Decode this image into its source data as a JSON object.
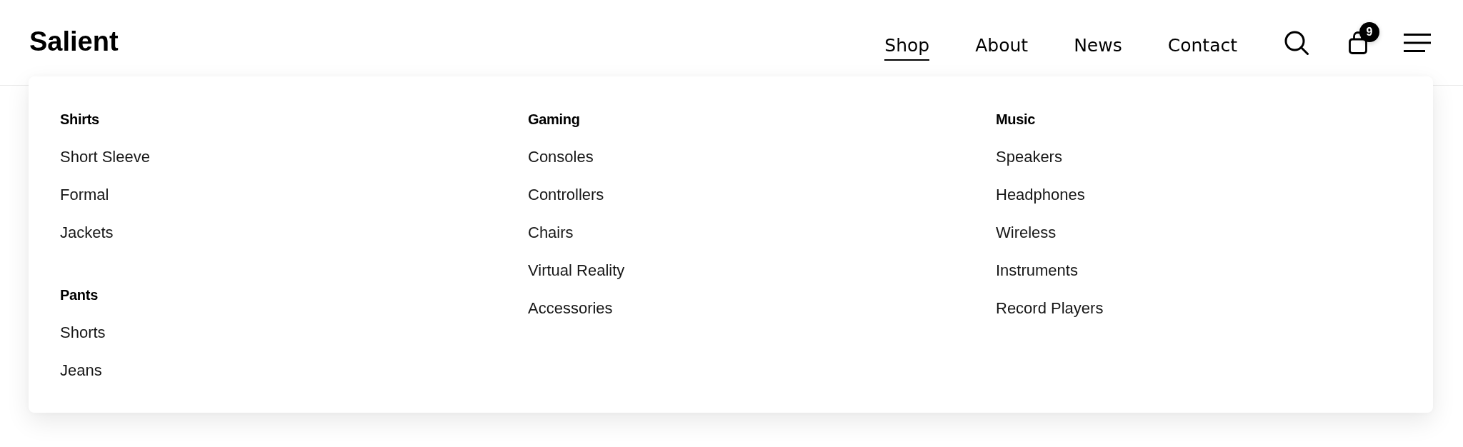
{
  "header": {
    "logo": "Salient",
    "nav": [
      {
        "label": "Shop",
        "selected": true
      },
      {
        "label": "About",
        "selected": false
      },
      {
        "label": "News",
        "selected": false
      },
      {
        "label": "Contact",
        "selected": false
      }
    ],
    "cart": {
      "count": "9"
    }
  },
  "mega_menu": {
    "columns": [
      {
        "groups": [
          {
            "heading": "Shirts",
            "items": [
              "Short Sleeve",
              "Formal",
              "Jackets"
            ]
          },
          {
            "heading": "Pants",
            "items": [
              "Shorts",
              "Jeans"
            ]
          }
        ]
      },
      {
        "groups": [
          {
            "heading": "Gaming",
            "items": [
              "Consoles",
              "Controllers",
              "Chairs",
              "Virtual Reality",
              "Accessories"
            ]
          }
        ]
      },
      {
        "groups": [
          {
            "heading": "Music",
            "items": [
              "Speakers",
              "Headphones",
              "Wireless",
              "Instruments",
              "Record Players"
            ]
          }
        ]
      }
    ]
  }
}
